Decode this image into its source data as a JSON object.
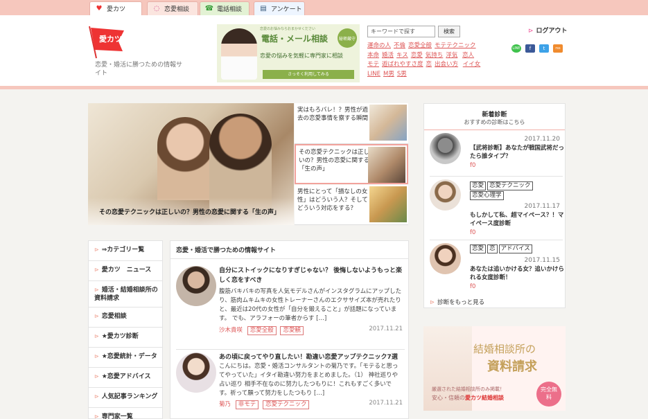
{
  "tabs": [
    {
      "label": "愛カツ",
      "icon": "heart-icon"
    },
    {
      "label": "恋愛相談",
      "icon": "chat-bubble-icon"
    },
    {
      "label": "電話相談",
      "icon": "phone-icon"
    },
    {
      "label": "アンケート",
      "icon": "clipboard-icon"
    }
  ],
  "header": {
    "logo_text": "愛カツ",
    "tagline": "恋愛・婚活に勝つための情報サイト",
    "banner": {
      "title": "電話・メール相談",
      "small": "恋愛のお悩みならおまかせください",
      "badge": "秘密厳守",
      "line": "恋愛の悩みを気軽に専門家に相談",
      "button": "さっそく利用してみる"
    },
    "search_placeholder": "キーワードで探す",
    "search_button": "検索",
    "login": "ログアウト",
    "tags": [
      "運命の人",
      "不倫",
      "恋愛全般",
      "モテテクニック",
      "本命",
      "婚活",
      "キス",
      "恋愛",
      "気持ち",
      "浮気",
      "恋人",
      "モテ",
      "遊ばれやすさ度",
      "恋",
      "出会い方",
      "イイ女",
      "LINE",
      "M男",
      "S男"
    ]
  },
  "social": [
    {
      "name": "line-icon",
      "label": "LINE",
      "color": "#3fc24c"
    },
    {
      "name": "facebook-icon",
      "label": "f",
      "color": "#3b5998"
    },
    {
      "name": "twitter-icon",
      "label": "t",
      "color": "#3da2e8"
    },
    {
      "name": "rss-icon",
      "label": "rss",
      "color": "#f08b2e"
    }
  ],
  "hero": {
    "caption": "その恋愛テクニックは正しいの？男性の恋愛に関する「生の声」"
  },
  "side_articles": [
    {
      "title": "実はもろバレ！？男性が過去の恋愛事情を察する瞬間"
    },
    {
      "title": "その恋愛テクニックは正しいの？男性の恋愛に関する「生の声」"
    },
    {
      "title": "男性にとって「損なしの女性」はどういう人？そしてどういう対応をする？"
    }
  ],
  "categories": [
    "⇒カテゴリー覧",
    "愛カツ　ニュース",
    "婚活・結婚相談所の資料請求",
    "恋愛相談",
    "★愛カツ診断",
    "★恋愛統計・データ",
    "★恋愛アドバイス",
    "人気記事ランキング",
    "専門家一覧"
  ],
  "main": {
    "heading": "恋愛・婚活で勝つための情報サイト",
    "posts": [
      {
        "title": "自分にストイックになりすぎじゃない？ 後悔しないようもっと楽しく恋をすべき",
        "body": "腹筋バキバキの写真を人気モデルさんがインスタグラムにアップしたり、筋肉ムキムキの女性トレーナーさんのエクササイズ本が売れたりと、最近は20代の女性が「自分を鍛えること」が話題になっています。 でも、アラフォーの筆者からす […]",
        "author": "沙木貴咲",
        "tags": [
          "恋愛全般",
          "恋愛観"
        ],
        "date": "2017.11.21"
      },
      {
        "title": "あの頃に戻ってやり直したい！勘違い恋愛アップテクニック7選",
        "body": "こんにちは。恋愛・婚活コンサルタントの菊乃です。「モテると思ってやっていた」イタイ勘違い努力をまとめました。（1） 神社巡りや占い巡り 相手不在なのに努力したつもりに！これもすごく多いです。祈って願って努力をしたつもり […]",
        "author": "菊乃",
        "tags": [
          "非モテ",
          "恋愛テクニック"
        ],
        "date": "2017.11.21"
      }
    ]
  },
  "diagnosis": {
    "title": "新着診断",
    "subtitle": "おすすめの診断はこちら",
    "items": [
      {
        "date": "2017.11.20",
        "tags": [],
        "title": "【武将診断】あなたが戦国武将だったら誰タイプ？",
        "likes": "0"
      },
      {
        "date": "2017.11.17",
        "tags": [
          "恋愛",
          "恋愛テクニック",
          "恋愛心理学"
        ],
        "title": "もしかして私、超マイペース？！マイペース度診断",
        "likes": "0"
      },
      {
        "date": "2017.11.15",
        "tags": [
          "恋愛",
          "恋",
          "アドバイス"
        ],
        "title": "あなたは追いかける女？追いかけられる女度診断！",
        "likes": "0"
      }
    ],
    "more": "診断をもっと見る"
  },
  "ad": {
    "title1": "結婚相談所の",
    "title2": "資料請求",
    "sub": "厳選された結婚相談所のみ掲載！",
    "sub2": "安心・信頼の",
    "brand": "愛カツ結婚相談",
    "badge": "完全無料"
  }
}
